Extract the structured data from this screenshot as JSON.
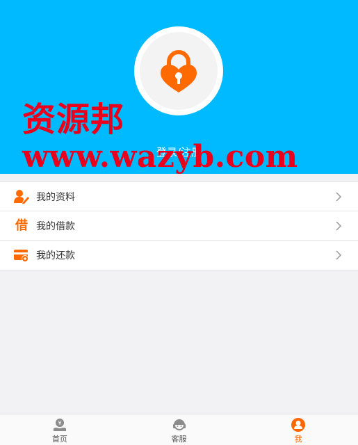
{
  "header": {
    "login_text": "登录/注册",
    "bg_color": "#00baff",
    "lock_color": "#ff6a00"
  },
  "watermark": {
    "line1": "资源邦",
    "line2": "www.wazyb.com",
    "color": "#e8001c"
  },
  "menu": {
    "items": [
      {
        "label": "我的资料",
        "icon": "profile-edit-icon"
      },
      {
        "label": "我的借款",
        "icon": "borrow-icon",
        "icon_text": "借"
      },
      {
        "label": "我的还款",
        "icon": "repay-card-icon"
      }
    ]
  },
  "tabbar": {
    "tabs": [
      {
        "label": "首页",
        "icon": "home-coin-icon",
        "active": false
      },
      {
        "label": "客服",
        "icon": "customer-service-icon",
        "active": false
      },
      {
        "label": "我",
        "icon": "user-icon",
        "active": true
      }
    ],
    "active_color": "#ff6600"
  }
}
